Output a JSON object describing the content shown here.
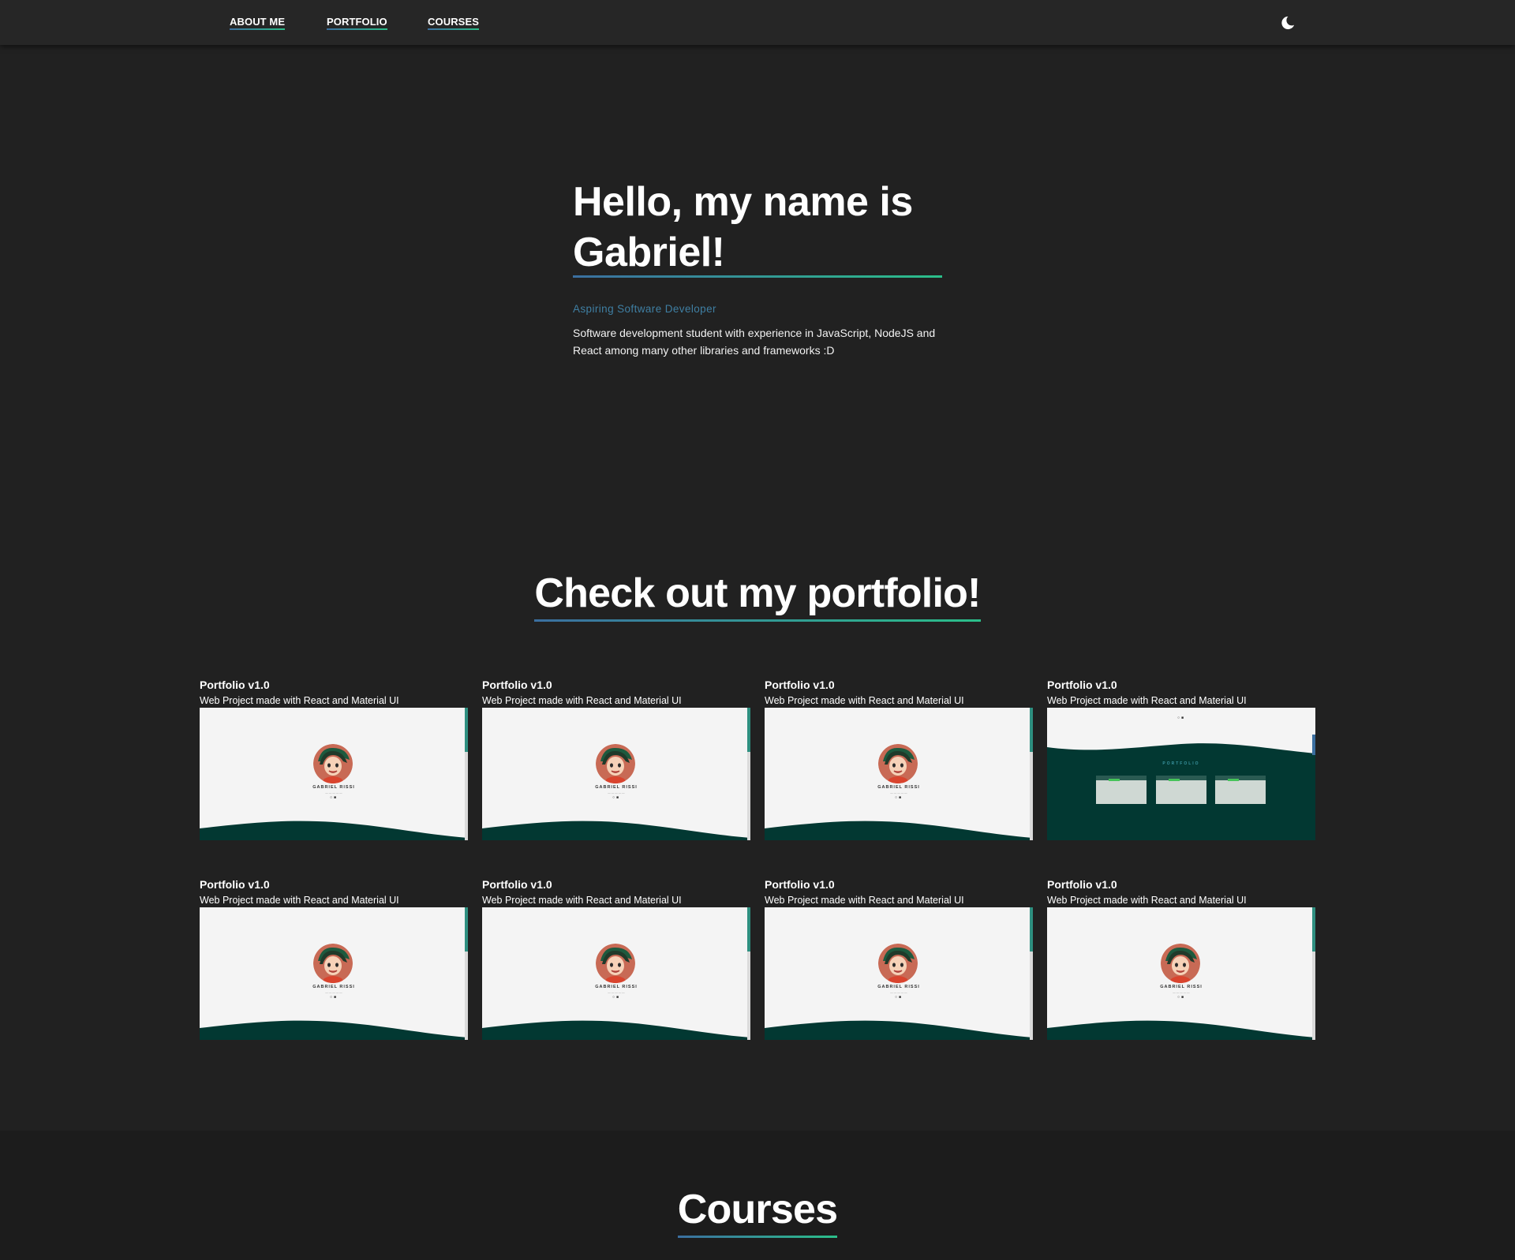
{
  "nav": {
    "links": [
      {
        "label": "ABOUT ME"
      },
      {
        "label": "PORTFOLIO"
      },
      {
        "label": "COURSES"
      }
    ],
    "theme_toggle_icon": "moon-icon"
  },
  "hero": {
    "title": "Hello, my name is Gabriel!",
    "subtitle": "Aspiring Software Developer",
    "description": "Software development student with experience in JavaScript, NodeJS and React among many other libraries and frameworks :D"
  },
  "portfolio": {
    "heading": "Check out my portfolio!",
    "projects": [
      {
        "title": "Portfolio v1.0",
        "subtitle": "Web Project made with React and Material UI",
        "preview": "hero"
      },
      {
        "title": "Portfolio v1.0",
        "subtitle": "Web Project made with React and Material UI",
        "preview": "hero"
      },
      {
        "title": "Portfolio v1.0",
        "subtitle": "Web Project made with React and Material UI",
        "preview": "hero"
      },
      {
        "title": "Portfolio v1.0",
        "subtitle": "Web Project made with React and Material UI",
        "preview": "portfolio"
      },
      {
        "title": "Portfolio v1.0",
        "subtitle": "Web Project made with React and Material UI",
        "preview": "hero"
      },
      {
        "title": "Portfolio v1.0",
        "subtitle": "Web Project made with React and Material UI",
        "preview": "hero"
      },
      {
        "title": "Portfolio v1.0",
        "subtitle": "Web Project made with React and Material UI",
        "preview": "hero"
      },
      {
        "title": "Portfolio v1.0",
        "subtitle": "Web Project made with React and Material UI",
        "preview": "hero"
      }
    ],
    "preview_text": {
      "name": "GABRIEL RISSI",
      "section": "PORTFOLIO"
    }
  },
  "courses": {
    "heading": "Courses"
  },
  "colors": {
    "background": "#212121",
    "topbar": "#262626",
    "accent_blue": "#3b6fa0",
    "accent_green": "#2bbf8a",
    "subtitle": "#3f7fa3",
    "preview_wave": "#023832"
  }
}
